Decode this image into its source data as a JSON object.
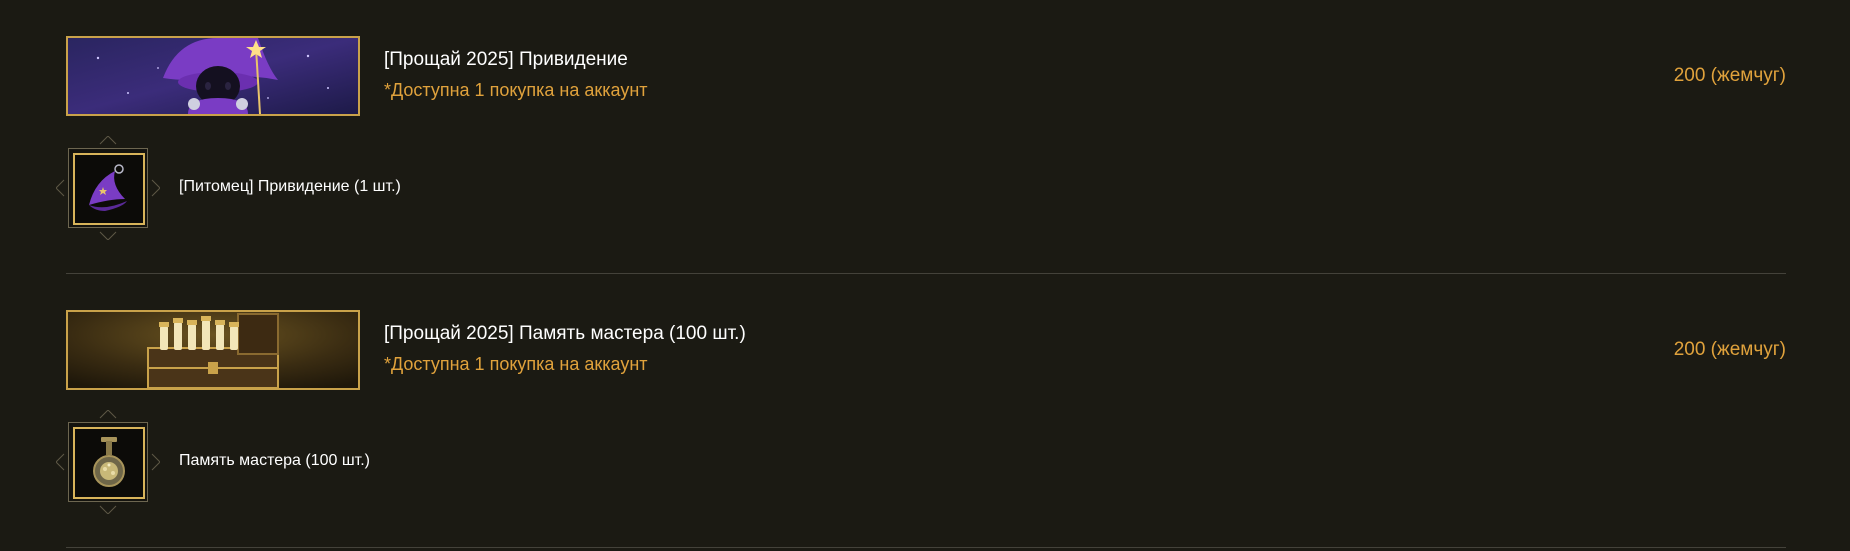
{
  "products": [
    {
      "title": "[Прощай 2025] Привидение",
      "limit": "*Доступна 1 покупка на аккаунт",
      "price": "200 (жемчуг)",
      "banner_icon": "ghost-wizard-pet-image",
      "item": {
        "name": "[Питомец] Привидение (1 шт.)",
        "icon": "purple-wizard-hat-icon"
      }
    },
    {
      "title": "[Прощай 2025] Память мастера (100 шт.)",
      "limit": "*Доступна 1 покупка на аккаунт",
      "price": "200 (жемчуг)",
      "banner_icon": "treasure-chest-image",
      "item": {
        "name": "Память мастера (100 шт.)",
        "icon": "master-memory-pendant-icon"
      }
    }
  ],
  "colors": {
    "background": "#1b1a13",
    "gold_border": "#c9a24a",
    "accent_orange": "#e0a23c",
    "text_white": "#ffffff",
    "divider": "#44423a"
  }
}
